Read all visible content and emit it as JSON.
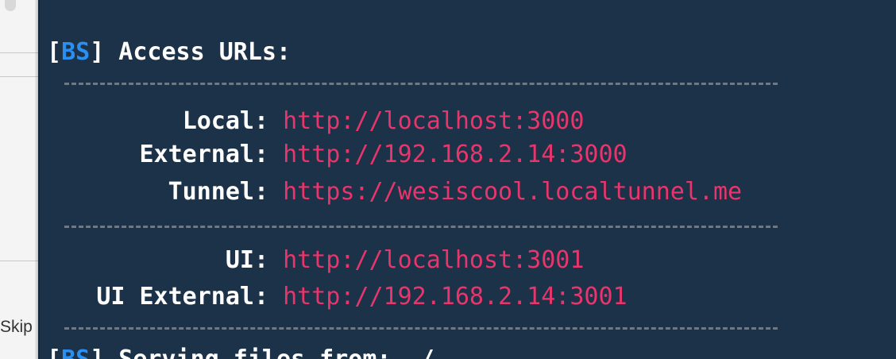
{
  "sidebar": {
    "skip_label": "Skip"
  },
  "terminal": {
    "header_prefix": "[",
    "header_tag": "BS",
    "header_suffix": "] Access URLs:",
    "rows": [
      {
        "label": "Local",
        "url": "http://localhost:3000"
      },
      {
        "label": "External",
        "url": "http://192.168.2.14:3000"
      },
      {
        "label": "Tunnel",
        "url": "https://wesiscool.localtunnel.me"
      },
      {
        "label": "UI",
        "url": "http://localhost:3001"
      },
      {
        "label": "UI External",
        "url": "http://192.168.2.14:3001"
      }
    ],
    "last_prefix": "[",
    "last_tag": "BS",
    "last_suffix": "] Serving files from: ./",
    "colors": {
      "background": "#1b3249",
      "tag": "#2b8ff0",
      "url": "#e8356b",
      "text": "#ffffff",
      "divider": "#6b7a86"
    }
  }
}
